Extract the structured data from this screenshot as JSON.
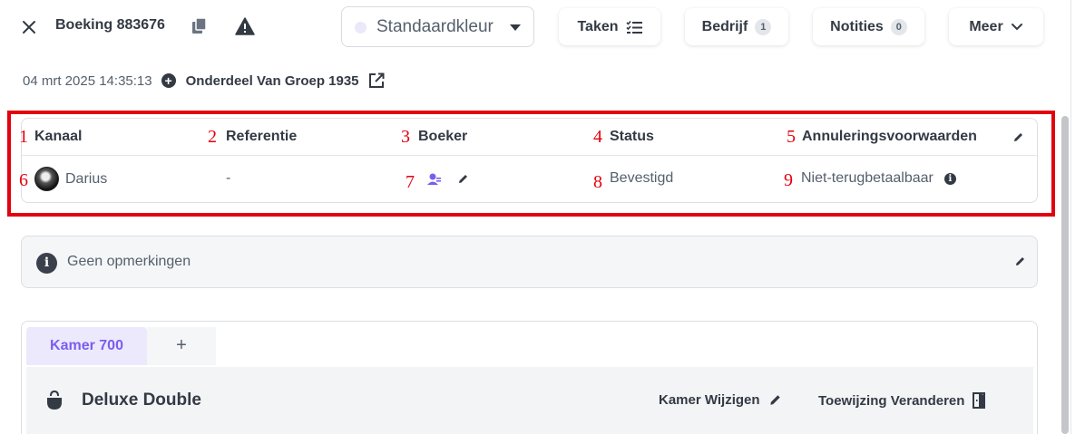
{
  "header": {
    "booking_title": "Boeking 883676",
    "color_select": {
      "value": "Standaardkleur",
      "dot_color": "#ebe8fa"
    },
    "buttons": {
      "taken": "Taken",
      "bedrijf": "Bedrijf",
      "bedrijf_count": "1",
      "notities": "Notities",
      "notities_count": "0",
      "meer": "Meer"
    }
  },
  "subheader": {
    "date": "04 mrt 2025 14:35:13",
    "group": "Onderdeel Van Groep 1935"
  },
  "annotations": [
    "1",
    "2",
    "3",
    "4",
    "5",
    "6",
    "7",
    "8",
    "9"
  ],
  "info": {
    "columns": [
      {
        "label": "Kanaal"
      },
      {
        "label": "Referentie"
      },
      {
        "label": "Boeker"
      },
      {
        "label": "Status"
      },
      {
        "label": "Annuleringsvoorwaarden"
      }
    ],
    "values": {
      "kanaal": "Darius",
      "referentie": "-",
      "status": "Bevestigd",
      "annulering": "Niet-terugbetaalbaar"
    }
  },
  "remarks": {
    "text": "Geen opmerkingen"
  },
  "rooms": {
    "tabs": [
      {
        "label": "Kamer 700"
      }
    ],
    "add_tab": "+",
    "room_name": "Deluxe Double",
    "actions": {
      "wijzigen": "Kamer Wijzigen",
      "toewijzing": "Toewijzing Veranderen"
    }
  },
  "colors": {
    "accent": "#7a5df0",
    "annotation_red": "#e3000f",
    "text_dark": "#333a44"
  }
}
